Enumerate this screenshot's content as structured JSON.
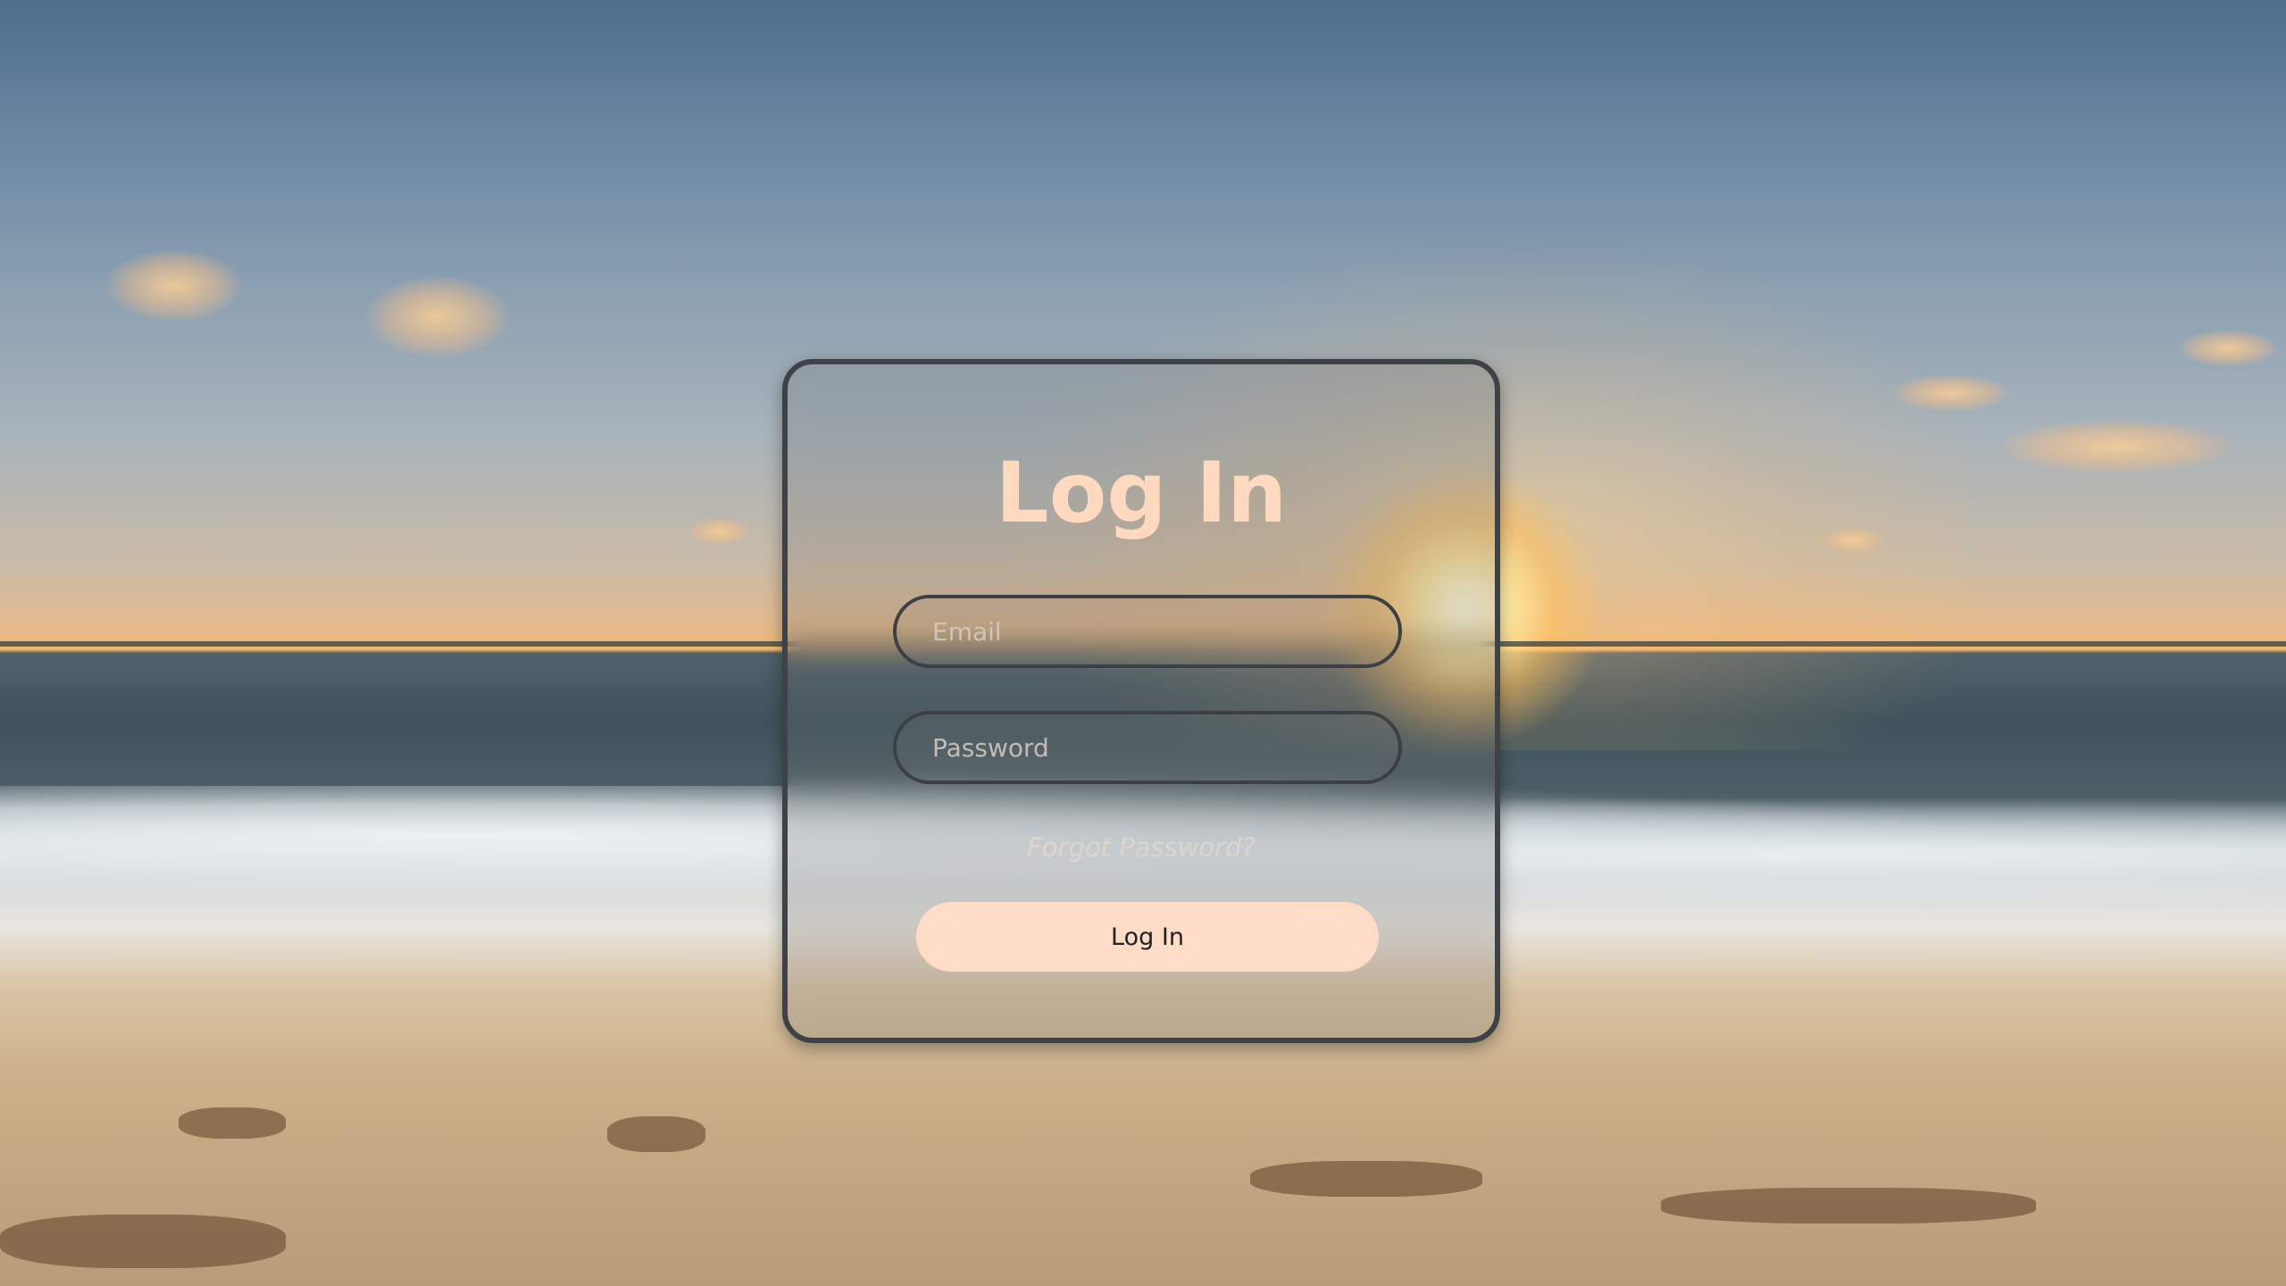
{
  "login": {
    "title": "Log In",
    "email": {
      "placeholder": "Email",
      "value": ""
    },
    "password": {
      "placeholder": "Password",
      "value": ""
    },
    "forgot_label": "Forgot Password?",
    "submit_label": "Log In"
  },
  "colors": {
    "title": "#ffd9bf",
    "button_bg": "#ffdcc6",
    "card_border": "#3e4247"
  }
}
